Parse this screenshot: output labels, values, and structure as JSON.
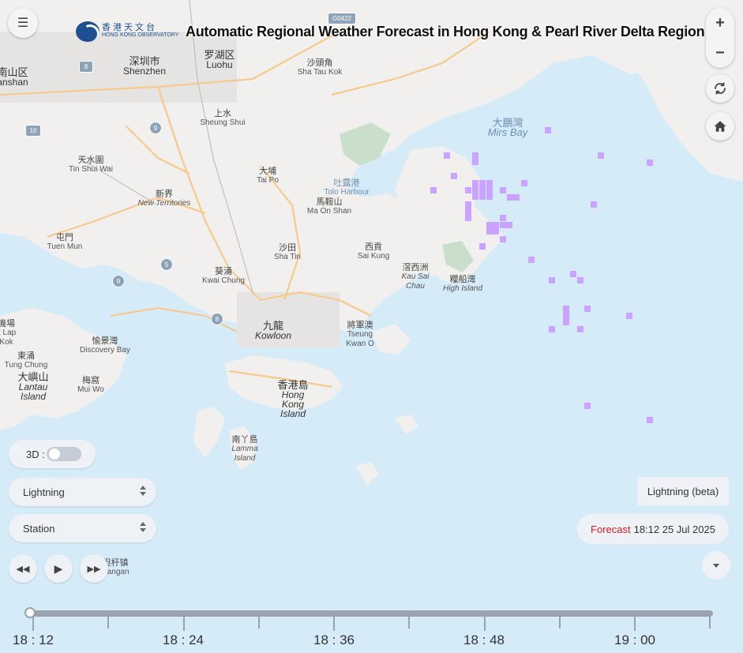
{
  "header": {
    "title": "Automatic Regional Weather Forecast in Hong Kong & Pearl River Delta Region",
    "logo_zh": "香港天文台",
    "logo_en": "HONG KONG OBSERVATORY"
  },
  "map_labels": [
    {
      "zh": "深圳市",
      "en": "Shenzhen"
    },
    {
      "zh": "罗湖区",
      "en": "Luohu"
    },
    {
      "zh": "沙頭角",
      "en": "Sha Tau Kok"
    },
    {
      "zh": "上水",
      "en": "Sheung Shui"
    },
    {
      "zh": "天水圍",
      "en": "Tin Shui Wai"
    },
    {
      "zh": "大埔",
      "en": "Tai Po"
    },
    {
      "zh": "新界",
      "en": "New Territories"
    },
    {
      "zh": "吐露港",
      "en": "Tolo Harbour"
    },
    {
      "zh": "馬鞍山",
      "en": "Ma On Shan"
    },
    {
      "zh": "屯門",
      "en": "Tuen Mun"
    },
    {
      "zh": "沙田",
      "en": "Sha Tin"
    },
    {
      "zh": "西貢",
      "en": "Sai Kung"
    },
    {
      "zh": "葵涌",
      "en": "Kwai Chung"
    },
    {
      "zh": "滘西洲",
      "en": "Kau Sai Chau"
    },
    {
      "zh": "糧船灣",
      "en": "High Island"
    },
    {
      "zh": "大鵬灣",
      "en": "Mirs Bay"
    },
    {
      "zh": "九龍",
      "en": "Kowloon"
    },
    {
      "zh": "將軍澳",
      "en": "Tseung Kwan O"
    },
    {
      "zh": "愉景灣",
      "en": "Discovery Bay"
    },
    {
      "zh": "東涌",
      "en": "Tung Chung"
    },
    {
      "zh": "大嶼山",
      "en": "Lantau Island"
    },
    {
      "zh": "梅窩",
      "en": "Mui Wo"
    },
    {
      "zh": "香港島",
      "en": "Hong Kong Island"
    },
    {
      "zh": "南丫島",
      "en": "Lamma Island"
    },
    {
      "zh": "担杆镇",
      "en": "Dangan"
    },
    {
      "zh": "南山区",
      "en": "anshan"
    },
    {
      "zh": "機場",
      "en": "k Lap"
    },
    {
      "zh": "",
      "en": "Kok"
    }
  ],
  "road_shields": [
    "G0422",
    "10",
    "9",
    "9",
    "5",
    "8",
    "8"
  ],
  "controls": {
    "menu_icon": "hamburger-icon",
    "zoom_in": "+",
    "zoom_out": "−",
    "toggle_3d_label": "3D :",
    "layer_select": "Lightning",
    "station_select": "Station",
    "layer_badge": "Lightning (beta)",
    "forecast_word": "Forecast",
    "forecast_time": "18:12 25 Jul 2025"
  },
  "timeline": {
    "labels": [
      "18 : 12",
      "18 : 24",
      "18 : 36",
      "18 : 48",
      "19 : 00"
    ],
    "current_fraction": 0
  },
  "colors": {
    "lightning": "#c9a3ff",
    "forecast_red": "#d11d1d",
    "sea": "#d6ebf8",
    "land": "#f1f0ee"
  }
}
